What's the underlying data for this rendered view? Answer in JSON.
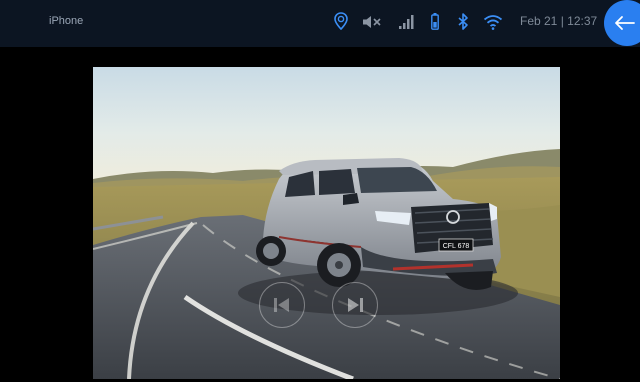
{
  "status_bar": {
    "device_name": "iPhone",
    "datetime": "Feb 21 | 12:37",
    "icons": [
      "location-icon",
      "mute-icon",
      "signal-icon",
      "battery-icon",
      "bluetooth-icon",
      "wifi-icon"
    ]
  },
  "back_button": {
    "icon": "back-arrow-icon"
  },
  "photo": {
    "license_plate": "CFL 678"
  },
  "playback_controls": [
    "previous-track-icon",
    "play-pause-icon"
  ],
  "colors": {
    "status_bar_bg": "#0c1522",
    "accent": "#2a7ff0",
    "icon_blue": "#3b8ef5",
    "icon_gray": "#8b95a3"
  }
}
